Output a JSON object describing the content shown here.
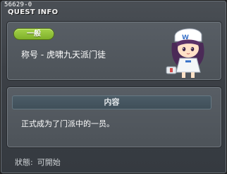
{
  "window": {
    "id_label": "56629-0",
    "title": "QUEST INFO"
  },
  "quest": {
    "category_badge": "一般",
    "name": "称号 - 虎啸九天派门徒",
    "npc_icon": "npc-portrait-icon"
  },
  "content": {
    "header": "内容",
    "text": "正式成为了门派中的一员。"
  },
  "status": {
    "label": "狀態:",
    "value": "可開始"
  },
  "colors": {
    "badge": "#8bbd32",
    "panel": "#555b61",
    "content_header": "#45555f"
  }
}
